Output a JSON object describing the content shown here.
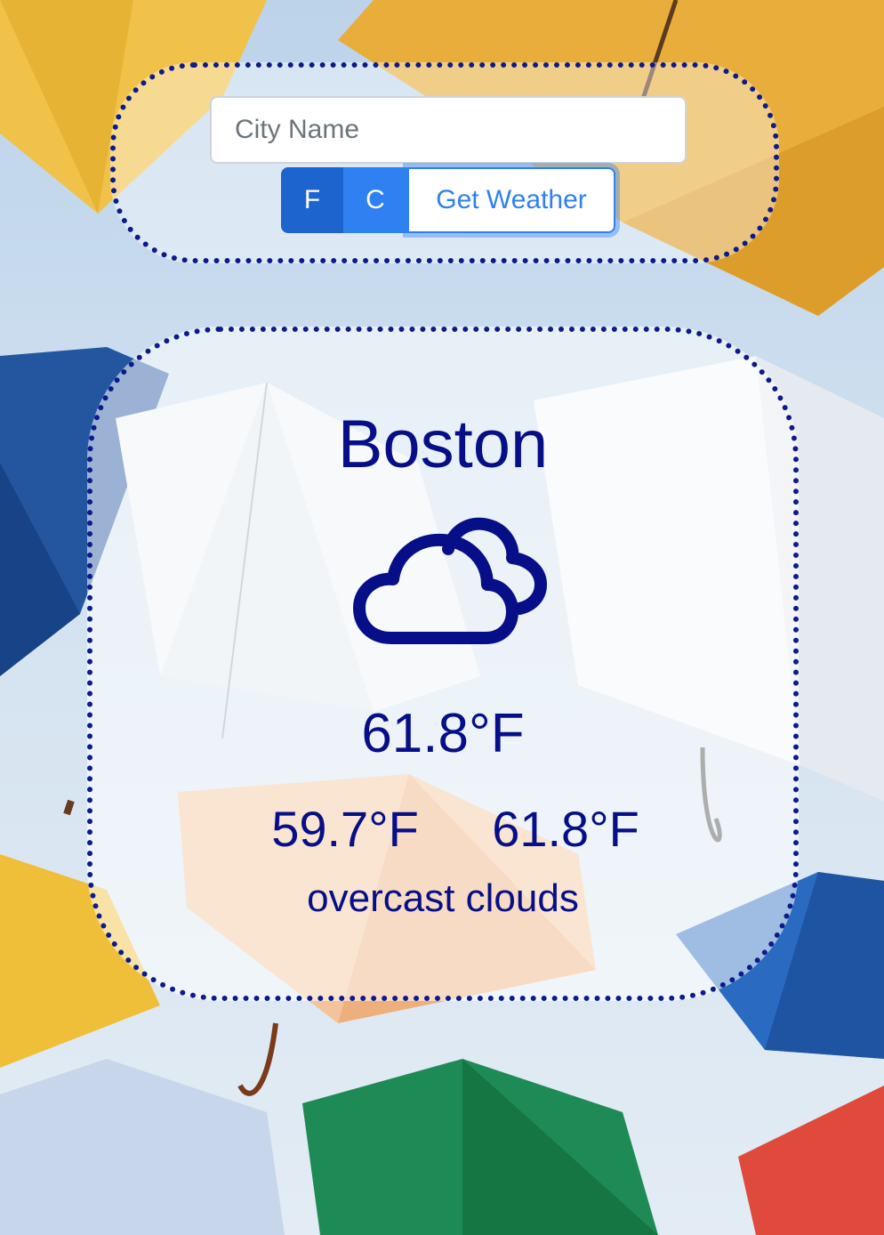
{
  "search": {
    "placeholder": "City Name",
    "value": ""
  },
  "units": {
    "fahrenheit_label": "F",
    "celsius_label": "C"
  },
  "get_weather_label": "Get Weather",
  "weather": {
    "city": "Boston",
    "icon": "clouds-icon",
    "temperature": "61.8°F",
    "temp_min": "59.7°F",
    "temp_max": "61.8°F",
    "description": "overcast clouds"
  },
  "colors": {
    "text": "#060f87",
    "border": "#0d1b8a",
    "button_active": "#1e64cf",
    "button": "#2f80f0"
  }
}
